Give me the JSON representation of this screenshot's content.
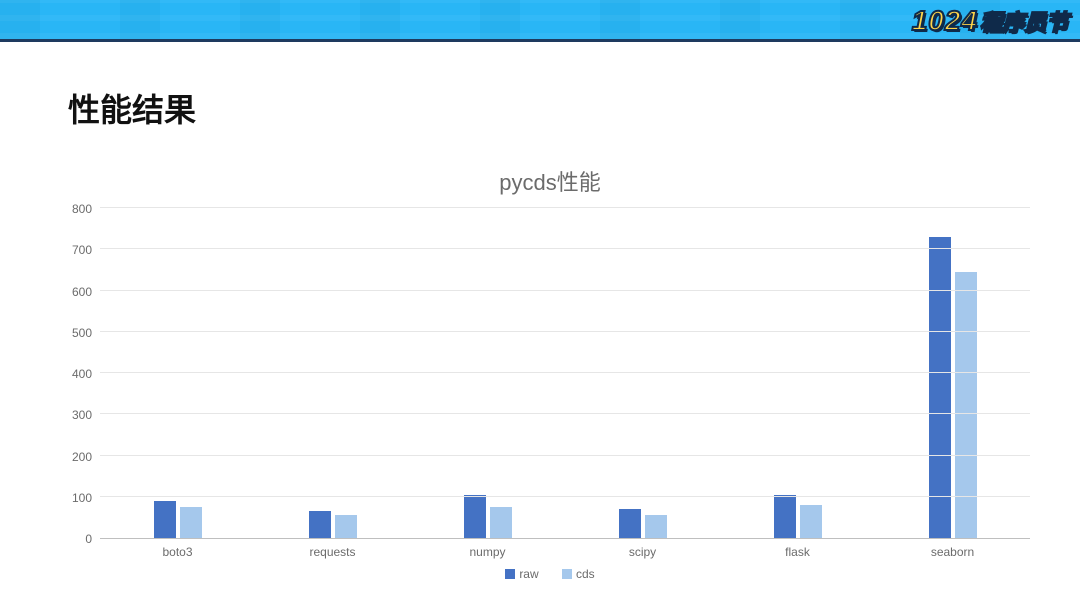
{
  "banner": {
    "badge_number": "1024",
    "badge_text": "程序员节"
  },
  "page_title": "性能结果",
  "chart_data": {
    "type": "bar",
    "title": "pycds性能",
    "categories": [
      "boto3",
      "requests",
      "numpy",
      "scipy",
      "flask",
      "seaborn"
    ],
    "series": [
      {
        "name": "raw",
        "values": [
          90,
          65,
          105,
          70,
          105,
          730
        ]
      },
      {
        "name": "cds",
        "values": [
          75,
          55,
          75,
          55,
          80,
          645
        ]
      }
    ],
    "ylim": [
      0,
      800
    ],
    "ytick_step": 100,
    "legend": [
      "raw",
      "cds"
    ],
    "colors": {
      "raw": "#4472c4",
      "cds": "#a5c8ec"
    }
  }
}
